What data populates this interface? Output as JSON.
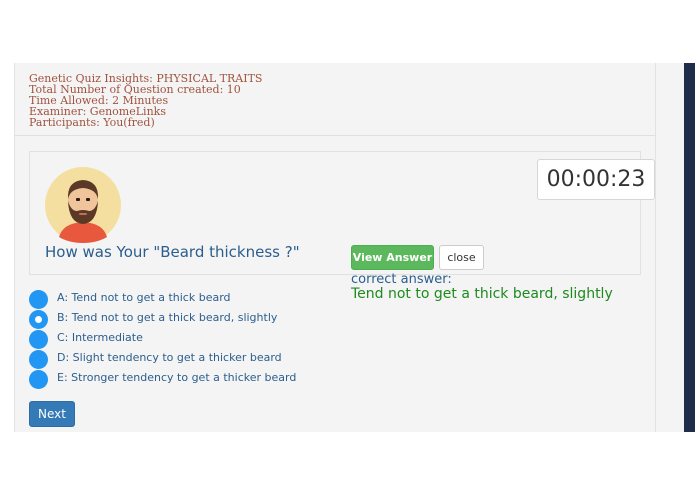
{
  "quiz_info": {
    "title": "Genetic Quiz Insights: PHYSICAL TRAITS",
    "total_questions": "Total Number of Question created: 10",
    "time_allowed": "Time Allowed: 2 Minutes",
    "examiner": "Examiner: GenomeLinks",
    "participants": "Participants: You(fred)"
  },
  "timer": {
    "value": "00:00:23"
  },
  "question": {
    "text": "How was Your \"Beard thickness ?\""
  },
  "buttons": {
    "view_answer": "View Answer",
    "close": "close",
    "next": "Next"
  },
  "answer": {
    "label": "correct answer:",
    "text": "Tend not to get a thick beard, slightly"
  },
  "options": [
    {
      "label": "A: Tend not to get a thick beard",
      "selected": false
    },
    {
      "label": "B: Tend not to get a thick beard, slightly",
      "selected": true
    },
    {
      "label": "C: Intermediate",
      "selected": false
    },
    {
      "label": "D: Slight tendency to get a thicker beard",
      "selected": false
    },
    {
      "label": "E: Stronger tendency to get a thicker beard",
      "selected": false
    }
  ],
  "colors": {
    "accent": "#2196f3",
    "success": "#5cb85c",
    "primary": "#337ab7",
    "answer": "#1e8a1e"
  }
}
